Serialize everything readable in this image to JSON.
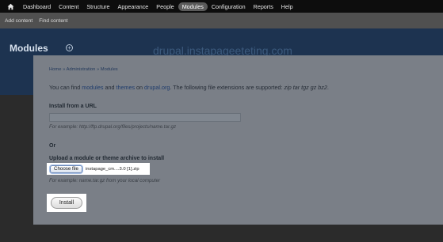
{
  "toolbar": {
    "items": [
      {
        "label": "Dashboard"
      },
      {
        "label": "Content"
      },
      {
        "label": "Structure"
      },
      {
        "label": "Appearance"
      },
      {
        "label": "People"
      },
      {
        "label": "Modules",
        "active": true
      },
      {
        "label": "Configuration"
      },
      {
        "label": "Reports"
      },
      {
        "label": "Help"
      }
    ]
  },
  "shortcuts": {
    "items": [
      {
        "label": "Add content"
      },
      {
        "label": "Find content"
      }
    ]
  },
  "header": {
    "title": "Modules",
    "plus_symbol": "+",
    "site_name": "drupal.instapageeteting.com"
  },
  "breadcrumb": {
    "items": [
      "Home",
      "Administration",
      "Modules"
    ],
    "separator": " » "
  },
  "intro": {
    "text_1": "You can find ",
    "link_modules": "modules",
    "text_2": " and ",
    "link_themes": "themes",
    "text_3": " on ",
    "link_drupal": "drupal.org",
    "text_4": ". The following file extensions are supported: ",
    "extensions": "zip tar tgz gz bz2",
    "text_5": "."
  },
  "install_url": {
    "label": "Install from a URL",
    "value": "",
    "description": "For example: http://ftp.drupal.org/files/projects/name.tar.gz"
  },
  "or_label": "Or",
  "upload": {
    "label": "Upload a module or theme archive to install",
    "choose_button": "Choose file",
    "file_name": "instapage_cm....3.0 [1].zip",
    "description": "For example: name.tar.gz from your local computer"
  },
  "install_button": "Install",
  "colors": {
    "toolbar": "#0d0d0d",
    "header": "#1d3350",
    "panel": "#7a7f87",
    "highlight": "#ffffff"
  }
}
